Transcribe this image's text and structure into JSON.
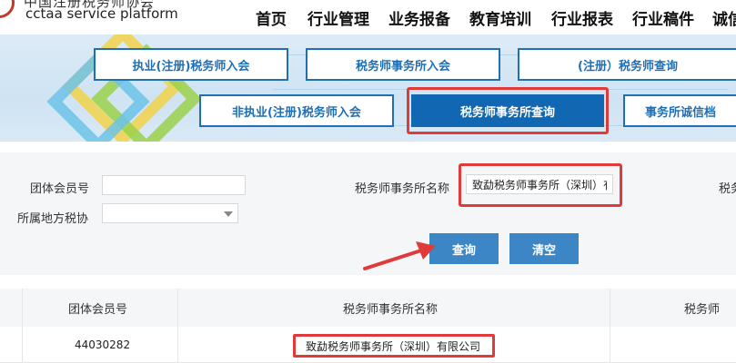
{
  "header": {
    "logo_cn": "中国注册税务师协会",
    "logo_en": "cctaa  service platform",
    "nav": [
      "首页",
      "行业管理",
      "业务报备",
      "教育培训",
      "行业报表",
      "行业稿件",
      "诚信"
    ]
  },
  "banner": {
    "buttons": [
      "执业(注册)税务师入会",
      "税务师事务所入会",
      "(注册）税务师查询",
      "非执业(注册)税务师入会",
      "税务师事务所查询",
      "事务所诚信档"
    ],
    "active_index": 4
  },
  "form": {
    "member_no_label": "团体会员号",
    "member_no_value": "",
    "firm_name_label": "税务师事务所名称",
    "firm_name_value": "致勐税务师事务所（深圳）有限公司",
    "third_label_partial": "税务",
    "region_label": "所属地方税协",
    "region_value": "",
    "query_button": "查询",
    "clear_button": "清空"
  },
  "table": {
    "headers": [
      "",
      "团体会员号",
      "税务师事务所名称",
      "税务师"
    ],
    "rows": [
      {
        "member_no": "44030282",
        "firm_name": "致勐税务师事务所（深圳）有限公司"
      }
    ]
  },
  "colors": {
    "accent_blue": "#1167b1",
    "button_blue": "#3d86c6",
    "highlight_red": "#e03a3a"
  }
}
